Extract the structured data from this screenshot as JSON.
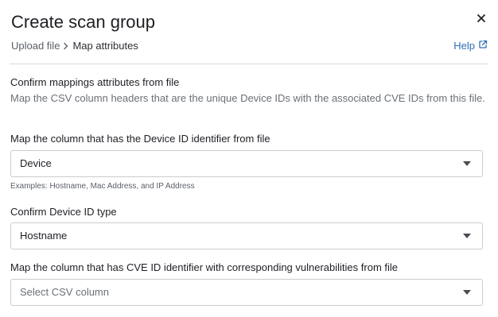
{
  "dialog": {
    "title": "Create scan group",
    "close_icon": "close-icon",
    "breadcrumb": {
      "step1": "Upload file",
      "separator_icon": "chevron-right-icon",
      "step2": "Map attributes"
    },
    "help": {
      "label": "Help",
      "icon": "external-link-icon",
      "color": "#2f6fb5"
    }
  },
  "section": {
    "title": "Confirm mappings attributes from file",
    "description": "Map the CSV column headers that are the unique Device IDs with the associated CVE IDs from this file."
  },
  "fields": {
    "device_id_column": {
      "label": "Map the column that has the Device ID identifier from file",
      "value": "Device",
      "hint": "Examples: Hostname, Mac Address, and IP Address"
    },
    "device_id_type": {
      "label": "Confirm Device ID type",
      "value": "Hostname"
    },
    "cve_column": {
      "label": "Map the column that has CVE ID identifier with corresponding vulnerabilities from file",
      "placeholder": "Select CSV column"
    }
  }
}
